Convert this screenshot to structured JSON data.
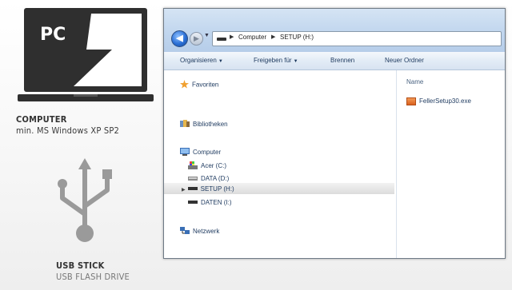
{
  "left": {
    "laptop_label": "PC",
    "computer_title": "COMPUTER",
    "computer_req": "min. MS Windows XP SP2",
    "usb_title": "USB STICK",
    "usb_subtitle": "USB FLASH DRIVE"
  },
  "explorer": {
    "address": {
      "crumb_1": "Computer",
      "crumb_2": "SETUP (H:)"
    },
    "toolbar": {
      "organize": "Organisieren",
      "share": "Freigeben für",
      "burn": "Brennen",
      "new_folder": "Neuer Ordner"
    },
    "nav": {
      "favorites": "Favoriten",
      "libraries": "Bibliotheken",
      "computer": "Computer",
      "drives": [
        "Acer (C:)",
        "DATA (D:)",
        "SETUP (H:)",
        "DATEN (I:)"
      ],
      "network": "Netzwerk",
      "selected_drive": "SETUP (H:)"
    },
    "content": {
      "column_name": "Name",
      "files": [
        "FellerSetup30.exe"
      ]
    }
  },
  "colors": {
    "window_frame": "#6f7a86",
    "titlebar": "#c1d6ee",
    "toolbar": "#e3ecf6",
    "nav_text": "#1e3a5f",
    "laptop": "#2f2f2f",
    "usb_icon": "#9a9a9a"
  }
}
